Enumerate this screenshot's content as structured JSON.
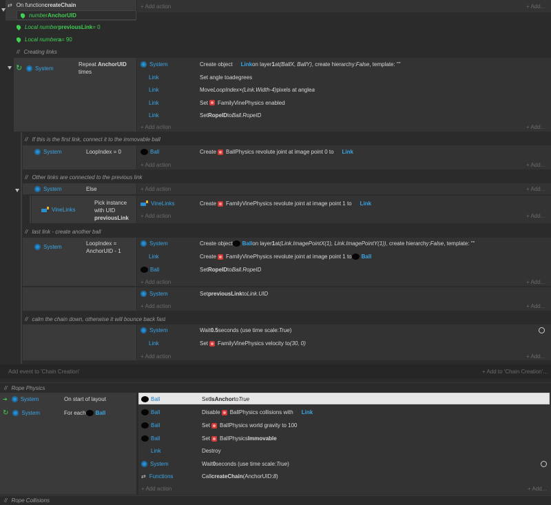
{
  "common": {
    "add_action": "+ Add action",
    "add_more": "+ Add...",
    "link": "Link",
    "ball": "Ball",
    "system": "System",
    "vinelinks": "VineLinks",
    "functions": "Functions"
  },
  "fn": {
    "prefix": "On function ",
    "name": "createChain",
    "param_kind": "number ",
    "param_name": "AnchorUID"
  },
  "locals": [
    {
      "prefix": "Local number ",
      "name": "previousLink",
      "suffix": " = 0"
    },
    {
      "prefix": "Local number ",
      "name": "a",
      "suffix": " = 90"
    }
  ],
  "comments": {
    "creating_links": "Creating links",
    "first_link": "If this is the first link, connect it to the immovable ball",
    "other_links": "Other links are connected to the previous link",
    "last_link": "last link - create another ball",
    "calm": "calm the chain down, otherwise it will bounce back fast",
    "rope_physics": "Rope Physics",
    "rope_collisions": "Rope Collisions"
  },
  "repeat": {
    "pre": "Repeat ",
    "name": "AnchorUID",
    "post": "times"
  },
  "a1": {
    "p1": "Create object ",
    "obj": "Link",
    "p2": " on layer ",
    "layer": "1",
    "p3": " at ",
    "pos": "(BallX, BallY)",
    "p4": ", create hierarchy: ",
    "h": "False",
    "p5": ", template: \"\""
  },
  "a2": {
    "p1": "Set angle to ",
    "v": "a",
    "p2": " degrees"
  },
  "a3": {
    "p1": "Move ",
    "v": "LoopIndex×(Link.Width-4)",
    "p2": " pixels at angle ",
    "v2": "a"
  },
  "a4": {
    "p1": "Set ",
    "p2": "FamilyVinePhysics enabled"
  },
  "a5": {
    "p1": "Set ",
    "name": "RopeID",
    "p2": " to ",
    "v": "Ball.RopeID"
  },
  "c_loop0": "LoopIndex = 0",
  "a6": {
    "p1": "Create ",
    "p2": "BallPhysics revolute joint at image point 0 to "
  },
  "c_else": "Else",
  "pick": {
    "l1": "Pick instance",
    "l2": "with UID",
    "name": "previousLink"
  },
  "a7": {
    "p1": "Create ",
    "p2": "FamilyVinePhysics revolute joint at image point 1 to "
  },
  "c_last": {
    "l1": "LoopIndex =",
    "l2": "AnchorUID - 1"
  },
  "a8": {
    "p1": "Create object ",
    "obj": "Ball",
    "p2": " on layer ",
    "layer": "1",
    "p3": " at ",
    "pos": "(Link.ImagePointX(1), Link.ImagePointY(1))",
    "p4": ", create hierarchy: ",
    "h": "False",
    "p5": ", template: \"\""
  },
  "a9": {
    "p1": "Create ",
    "p2": "FamilyVinePhysics revolute joint at image point 1 to "
  },
  "a10": {
    "p1": "Set ",
    "name": "RopeID",
    "p2": " to ",
    "v": "Ball.RopeID"
  },
  "a11": {
    "p1": "Set ",
    "name": "previousLink",
    "p2": " to ",
    "v": "Link.UID"
  },
  "a12": {
    "p1": "Wait ",
    "v": "0.5",
    "p2": " seconds (use time scale: ",
    "t": "True",
    "p3": ")"
  },
  "a13": {
    "p1": "Set ",
    "p2": "FamilyVinePhysics velocity to ",
    "v": "(30, 0)"
  },
  "add_event": "Add event to 'Chain Creation'",
  "add_to": "+ Add to 'Chain Creation'...",
  "rp_start": "On start of layout",
  "rp_foreach": "For each ",
  "r1": {
    "p1": "Set ",
    "name": "IsAnchor",
    "p2": " to ",
    "v": "True"
  },
  "r2": {
    "p1": "Disable ",
    "p2": "BallPhysics collisions with "
  },
  "r3": {
    "p1": "Set ",
    "p2": "BallPhysics world gravity to 100"
  },
  "r4": {
    "p1": "Set ",
    "p2": "BallPhysics ",
    "name": "Immovable"
  },
  "r5": "Destroy",
  "r6": {
    "p1": "Wait ",
    "v": "0",
    "p2": " seconds (use time scale: ",
    "t": "True",
    "p3": ")"
  },
  "r7": {
    "p1": "Call ",
    "name": "createChain",
    "p2": " (AnchorUID: ",
    "v": "8",
    "p3": ")"
  }
}
